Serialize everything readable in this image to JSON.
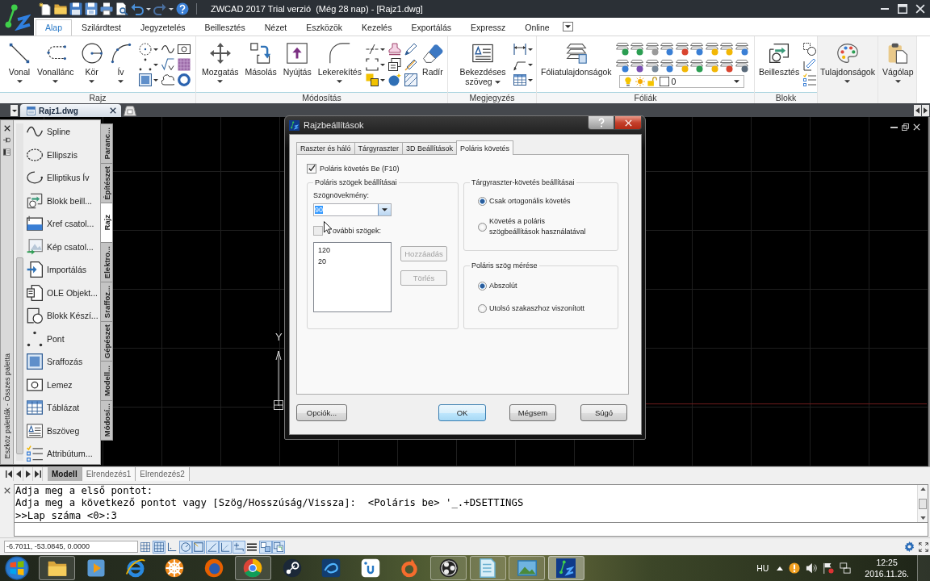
{
  "title_bar": {
    "title": "ZWCAD 2017 Trial verzió  (Még 28 nap) - [Rajz1.dwg]"
  },
  "ribbon_tabs": [
    {
      "label": "Alap",
      "selected": true
    },
    {
      "label": "Szilárdtest",
      "selected": false
    },
    {
      "label": "Jegyzetelés",
      "selected": false
    },
    {
      "label": "Beillesztés",
      "selected": false
    },
    {
      "label": "Nézet",
      "selected": false
    },
    {
      "label": "Eszközök",
      "selected": false
    },
    {
      "label": "Kezelés",
      "selected": false
    },
    {
      "label": "Exportálás",
      "selected": false
    },
    {
      "label": "Expressz",
      "selected": false
    },
    {
      "label": "Online",
      "selected": false
    }
  ],
  "ribbon_groups": [
    {
      "label": "Rajz",
      "tools": [
        {
          "label": "Vonal",
          "dropdown": true
        },
        {
          "label": "Vonallánc",
          "dropdown": true
        },
        {
          "label": "Kör",
          "dropdown": true
        },
        {
          "label": "Ív",
          "dropdown": true
        }
      ]
    },
    {
      "label": "Módosítás",
      "tools": [
        {
          "label": "Mozgatás",
          "dropdown": true
        },
        {
          "label": "Másolás",
          "dropdown": false
        },
        {
          "label": "Nyújtás",
          "dropdown": false
        },
        {
          "label": "Lekerekítés",
          "dropdown": true
        },
        {
          "label": "Radír",
          "dropdown": false
        }
      ]
    },
    {
      "label": "Megjegyzés",
      "tools": [
        {
          "label": "Bekezdéses szöveg",
          "dropdown": true
        }
      ]
    },
    {
      "label": "Fóliák",
      "tools": [
        {
          "label": "Fóliatulajdonságok",
          "dropdown": false
        }
      ],
      "layer_selector": {
        "value": "0"
      }
    },
    {
      "label": "Blokk",
      "tools": [
        {
          "label": "Beillesztés",
          "dropdown": false
        }
      ]
    },
    {
      "tools": [
        {
          "label": "Tulajdonságok",
          "dropdown": true
        }
      ]
    },
    {
      "tools": [
        {
          "label": "Vágólap",
          "dropdown": true
        }
      ]
    }
  ],
  "document_tabs": [
    {
      "label": "Rajz1.dwg",
      "selected": true
    }
  ],
  "tool_palette": {
    "title": "Eszköz paletták - Összes paletta",
    "items": [
      "Spline",
      "Ellipszis",
      "Elliptikus Ív",
      "Blokk beill...",
      "Xref csatol...",
      "Kép csatol...",
      "Importálás",
      "OLE Objekt...",
      "Blokk Készí...",
      "Pont",
      "Sraffozás",
      "Lemez",
      "Táblázat",
      "Bszöveg",
      "Attribútum..."
    ],
    "tabs": [
      {
        "label": "Paranc...",
        "selected": false
      },
      {
        "label": "Építészet",
        "selected": false
      },
      {
        "label": "Rajz",
        "selected": true
      },
      {
        "label": "Elektro...",
        "selected": false
      },
      {
        "label": "Sraffoz...",
        "selected": false
      },
      {
        "label": "Gépészet",
        "selected": false
      },
      {
        "label": "Modell...",
        "selected": false
      },
      {
        "label": "Módosí...",
        "selected": false
      }
    ]
  },
  "ucs_icon": {
    "y_label": "Y"
  },
  "dialog": {
    "title": "Rajzbeállítások",
    "tabs": [
      {
        "label": "Raszter és háló",
        "selected": false
      },
      {
        "label": "Tárgyraszter",
        "selected": false
      },
      {
        "label": "3D Beállítások",
        "selected": false
      },
      {
        "label": "Poláris követés",
        "selected": true
      }
    ],
    "polar_tracking": {
      "label": "Poláris követés Be (F10)",
      "checked": true
    },
    "angle_settings": {
      "title": "Poláris szögek beállításai",
      "increment_label": "Szögnövekmény:",
      "increment_value": "90",
      "increment_highlighted": true,
      "additional_angles": {
        "label": "ovábbi szögek:",
        "checked": false
      },
      "angle_list": [
        "120",
        "20"
      ],
      "buttons": [
        {
          "label": "Hozzáadás",
          "disabled": true
        },
        {
          "label": "Törlés",
          "disabled": true
        }
      ]
    },
    "object_snap_tracking": {
      "title": "Tárgyraszter-követés beállításai",
      "options": [
        {
          "label": "Csak ortogonális követés",
          "selected": true
        },
        {
          "label": "Követés a poláris szögbeállítások használatával",
          "selected": false
        }
      ]
    },
    "angle_measurement": {
      "title": "Poláris szög mérése",
      "options": [
        {
          "label": "Abszolút",
          "selected": true
        },
        {
          "label": "Utolsó szakaszhoz viszonított",
          "selected": false
        }
      ]
    },
    "buttons": [
      {
        "label": "Opciók...",
        "default": false
      },
      {
        "label": "OK",
        "default": true
      },
      {
        "label": "Mégsem",
        "default": false
      },
      {
        "label": "Súgó",
        "default": false
      }
    ]
  },
  "layout_tabs": [
    {
      "label": "Modell",
      "selected": true
    },
    {
      "label": "Elrendezés1",
      "selected": false
    },
    {
      "label": "Elrendezés2",
      "selected": false
    }
  ],
  "command_lines": [
    "Adja meg a első pontot:",
    "Adja meg a következő pontot vagy [Szög/Hosszúság/Vissza]:  <Poláris be> '_.+DSETTINGS",
    ">>Lap száma <0>:3"
  ],
  "status_bar": {
    "coordinates": "-6.7011, -53.0845, 0.0000",
    "toggles": [
      {
        "on": false
      },
      {
        "on": true
      },
      {
        "on": false
      },
      {
        "on": true
      },
      {
        "on": true
      },
      {
        "on": true
      },
      {
        "on": true
      },
      {
        "on": true
      },
      {
        "on": false
      },
      {
        "on": true
      },
      {
        "on": true
      }
    ]
  },
  "taskbar": {
    "apps": [
      {
        "running": true,
        "active": false
      },
      {
        "running": false,
        "active": false
      },
      {
        "running": false,
        "active": false
      },
      {
        "running": false,
        "active": false
      },
      {
        "running": false,
        "active": false
      },
      {
        "running": true,
        "active": false
      },
      {
        "running": false,
        "active": false
      },
      {
        "running": false,
        "active": false
      },
      {
        "running": false,
        "active": false
      },
      {
        "running": false,
        "active": false
      },
      {
        "running": true,
        "active": false
      },
      {
        "running": true,
        "active": false
      },
      {
        "running": true,
        "active": false
      },
      {
        "running": true,
        "active": true
      }
    ],
    "language": "HU",
    "time": "12:25",
    "date": "2016.11.26."
  }
}
